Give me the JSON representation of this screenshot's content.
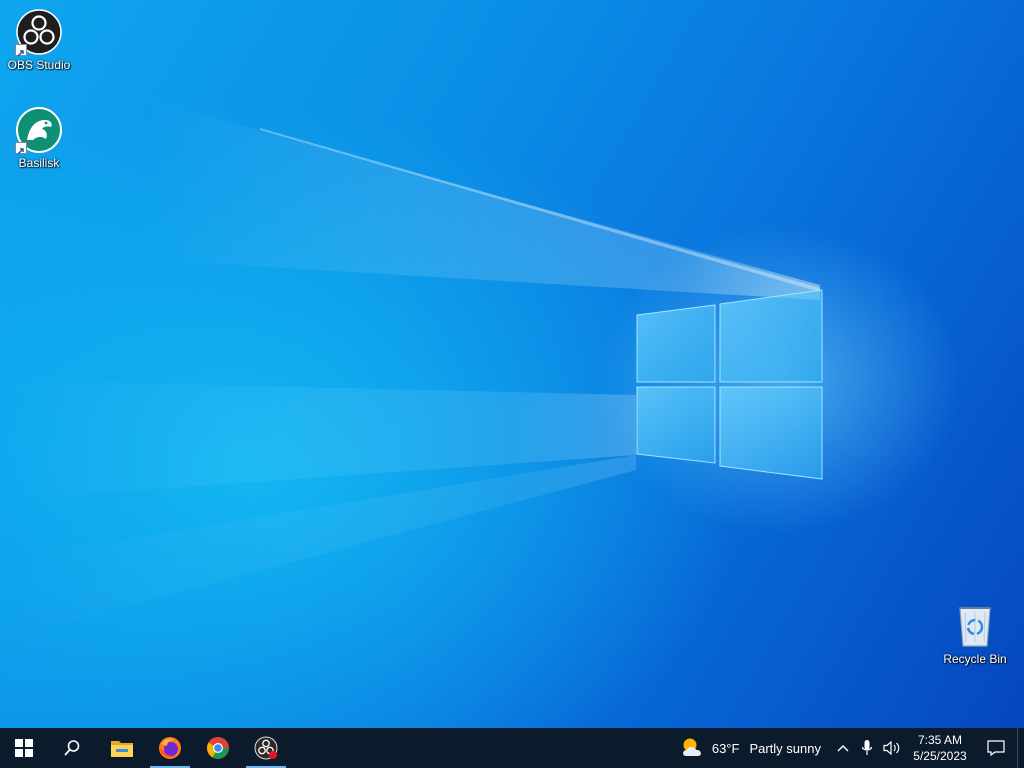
{
  "desktop": {
    "icons": [
      {
        "label": "OBS Studio",
        "icon": "obs-studio-icon"
      },
      {
        "label": "Basilisk",
        "icon": "basilisk-icon"
      },
      {
        "label": "Recycle Bin",
        "icon": "recycle-bin-icon"
      }
    ]
  },
  "taskbar": {
    "start": {
      "icon": "windows-logo-icon"
    },
    "search": {
      "icon": "search-icon"
    },
    "pinned": [
      {
        "name": "File Explorer",
        "icon": "folder-icon",
        "running": false
      },
      {
        "name": "Firefox",
        "icon": "firefox-icon",
        "running": true
      },
      {
        "name": "Google Chrome",
        "icon": "chrome-icon",
        "running": false
      },
      {
        "name": "OBS Studio",
        "icon": "obs-studio-icon",
        "running": true
      }
    ],
    "weather": {
      "temp": "63°F",
      "condition": "Partly sunny",
      "icon": "partly-sunny-icon"
    },
    "tray": {
      "chevron": "chevron-up-icon",
      "mic": "microphone-icon",
      "volume": "volume-icon"
    },
    "clock": {
      "time": "7:35 AM",
      "date": "5/25/2023"
    },
    "notifications": {
      "icon": "action-center-icon"
    }
  },
  "colors": {
    "taskbar_bg": "#0c1b2b",
    "running_indicator": "#6fb6ee",
    "wallpaper_accent": "#0fa6ef"
  }
}
